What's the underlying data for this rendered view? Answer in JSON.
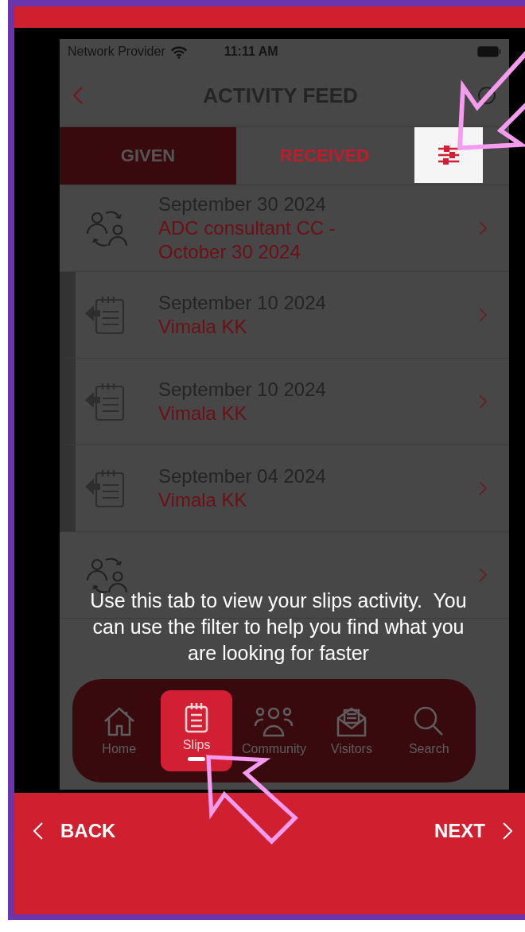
{
  "status_bar": {
    "carrier": "Network Provider",
    "time": "11:11 AM"
  },
  "header": {
    "title": "ACTIVITY FEED"
  },
  "tabs": [
    {
      "label": "GIVEN",
      "selected": true
    },
    {
      "label": "RECEIVED",
      "selected": false
    }
  ],
  "feed": [
    {
      "kind": "exchange",
      "date": "September 30 2024",
      "title": "ADC consultant CC - October 30 2024"
    },
    {
      "kind": "slip",
      "date": "September 10 2024",
      "title": "Vimala KK"
    },
    {
      "kind": "slip",
      "date": "September 10 2024",
      "title": "Vimala KK"
    },
    {
      "kind": "slip",
      "date": "September 04 2024",
      "title": "Vimala KK"
    },
    {
      "kind": "exchange"
    }
  ],
  "tooltip": {
    "text": "Use this tab to view your slips activity.  You can use the filter to help you find what you are looking for faster"
  },
  "nav": [
    {
      "kind": "home",
      "label": "Home",
      "selected": false
    },
    {
      "kind": "slips",
      "label": "Slips",
      "selected": true
    },
    {
      "kind": "community",
      "label": "Community",
      "selected": false
    },
    {
      "kind": "visitors",
      "label": "Visitors",
      "selected": false
    },
    {
      "kind": "search",
      "label": "Search",
      "selected": false
    }
  ],
  "footer": {
    "back": "BACK",
    "next": "NEXT"
  }
}
